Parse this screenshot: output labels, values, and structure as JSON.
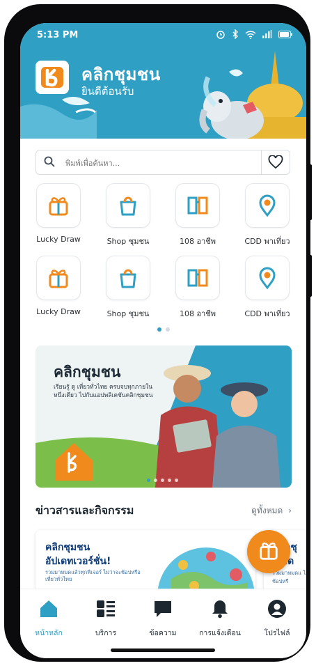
{
  "status_bar": {
    "time": "5:13 PM"
  },
  "header": {
    "title": "คลิกชุมชน",
    "subtitle": "ยินดีต้อนรับ"
  },
  "search": {
    "placeholder": "พิมพ์เพื่อค้นหา..."
  },
  "quick_menu": {
    "items": [
      {
        "label": "Lucky Draw",
        "icon": "gift-icon"
      },
      {
        "label": "Shop ชุมชน",
        "icon": "shopping-bag-icon"
      },
      {
        "label": "108 อาชีพ",
        "icon": "book-icon"
      },
      {
        "label": "CDD พาเที่ยว",
        "icon": "map-pin-icon"
      },
      {
        "label": "Lucky Draw",
        "icon": "gift-icon"
      },
      {
        "label": "Shop ชุมชน",
        "icon": "shopping-bag-icon"
      },
      {
        "label": "108 อาชีพ",
        "icon": "book-icon"
      },
      {
        "label": "CDD พาเที่ยว",
        "icon": "map-pin-icon"
      }
    ],
    "page_count": 2,
    "active_page": 0
  },
  "banner": {
    "title": "คลิกชุมชน",
    "text": "เรียนรู้ ดู เที่ยวทั่วไทย ครบจบทุกภายในหนึ่งเดียว ไปกับแอปพลิเคชันคลิกชุมชน",
    "page_count": 5,
    "active_page": 0
  },
  "news": {
    "title": "ข่าวสารและกิจกรรม",
    "see_all": "ดูทั้งหมด",
    "cards": [
      {
        "title_line1": "คลิกชุมชน",
        "title_line2": "อัปเดทเวอร์ชั่น!",
        "caption": "รวมมาหมดแล้วทุกฟีเจอร์ ไม่ว่าจะช้อปหรือเที่ยวทั่วไทย"
      },
      {
        "title_line1": "คลิกชุ",
        "title_line2": "อัปเด",
        "caption": "รวมมาหมดแ ไม่ว่าจะช้อปหรื"
      }
    ]
  },
  "bottom_nav": {
    "items": [
      {
        "label": "หน้าหลัก",
        "icon": "home-icon",
        "active": true
      },
      {
        "label": "บริการ",
        "icon": "services-grid-icon",
        "active": false
      },
      {
        "label": "ข้อความ",
        "icon": "chat-icon",
        "active": false
      },
      {
        "label": "การแจ้งเตือน",
        "icon": "bell-icon",
        "active": false
      },
      {
        "label": "โปรไฟล์",
        "icon": "profile-icon",
        "active": false
      }
    ]
  },
  "colors": {
    "primary": "#2f9fc4",
    "accent": "#f08a1c",
    "text_dark": "#1c2730"
  }
}
